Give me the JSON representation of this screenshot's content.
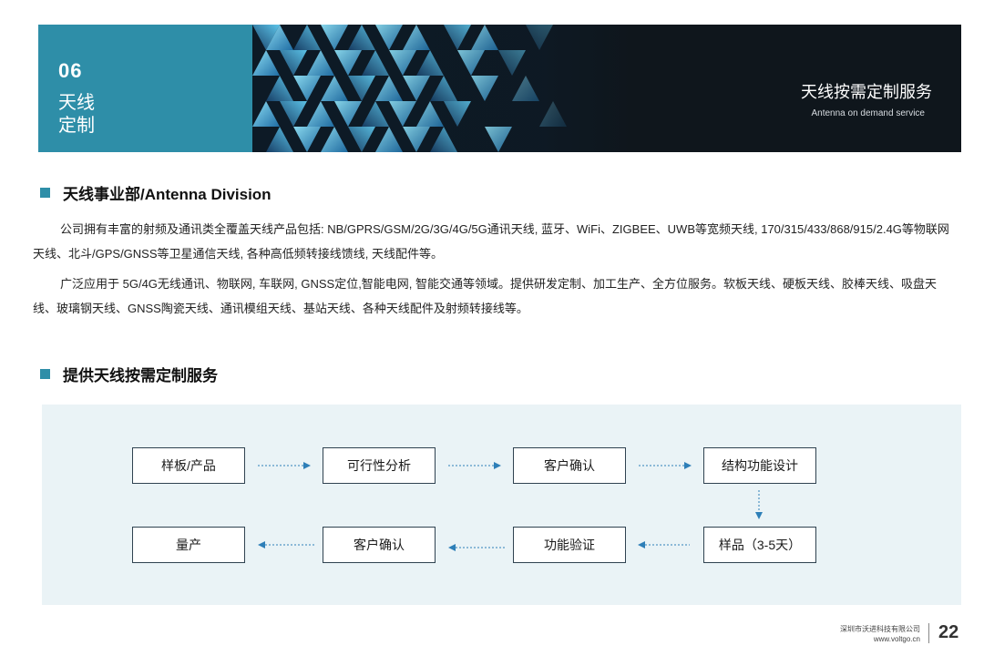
{
  "banner": {
    "chapter_number": "06",
    "chapter_title_line1": "天线",
    "chapter_title_line2": "定制",
    "title": "天线按需定制服务",
    "subtitle": "Antenna on demand service"
  },
  "section1": {
    "heading": "天线事业部/Antenna Division",
    "paragraph1": "公司拥有丰富的射频及通讯类全覆盖天线产品包括: NB/GPRS/GSM/2G/3G/4G/5G通讯天线, 蓝牙、WiFi、ZIGBEE、UWB等宽频天线, 170/315/433/868/915/2.4G等物联网天线、北斗/GPS/GNSS等卫星通信天线, 各种高低频转接线馈线, 天线配件等。",
    "paragraph2": "广泛应用于 5G/4G无线通讯、物联网, 车联网, GNSS定位,智能电网, 智能交通等领域。提供研发定制、加工生产、全方位服务。软板天线、硬板天线、胶棒天线、吸盘天线、玻璃钢天线、GNSS陶瓷天线、通讯模组天线、基站天线、各种天线配件及射频转接线等。"
  },
  "section2": {
    "heading": "提供天线按需定制服务"
  },
  "flow": {
    "row1": [
      "样板/产品",
      "可行性分析",
      "客户确认",
      "结构功能设计"
    ],
    "row2": [
      "量产",
      "客户确认",
      "功能验证",
      "样品（3-5天）"
    ]
  },
  "footer": {
    "company": "深圳市沃进科技有限公司",
    "url": "www.voltgo.cn",
    "page": "22"
  },
  "colors": {
    "accent": "#2e8ea8",
    "banner_dark": "#0f161c",
    "flow_bg": "#eaf3f6",
    "arrow": "#2e7fb8"
  }
}
